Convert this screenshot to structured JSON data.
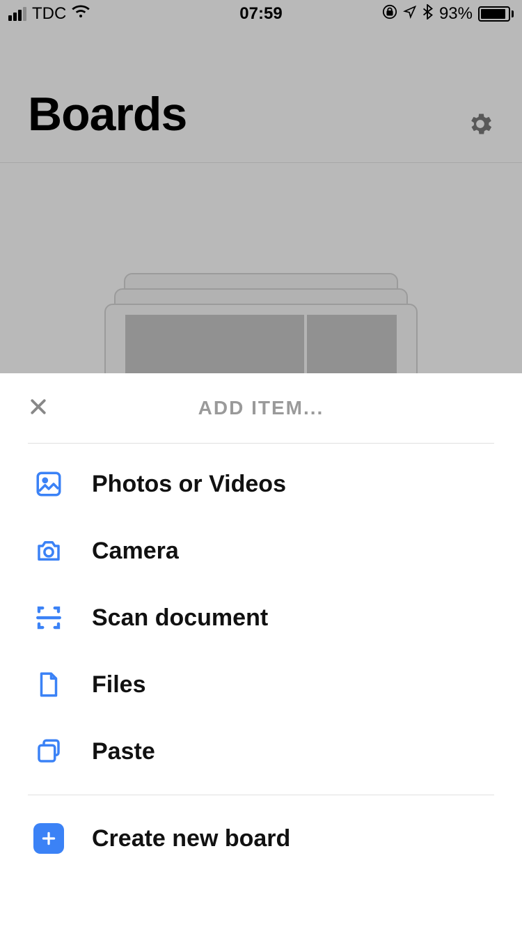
{
  "status": {
    "carrier": "TDC",
    "time": "07:59",
    "battery_pct": "93%"
  },
  "header": {
    "title": "Boards"
  },
  "sheet": {
    "title": "ADD ITEM...",
    "items": [
      {
        "label": "Photos or Videos"
      },
      {
        "label": "Camera"
      },
      {
        "label": "Scan document"
      },
      {
        "label": "Files"
      },
      {
        "label": "Paste"
      }
    ],
    "create": {
      "label": "Create new board"
    }
  }
}
